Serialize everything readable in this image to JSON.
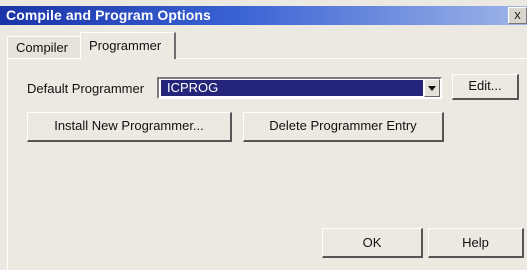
{
  "window": {
    "title": "Compile and Program Options",
    "close_label": "x"
  },
  "tabs": [
    {
      "label": "Compiler",
      "selected": false
    },
    {
      "label": "Programmer",
      "selected": true
    }
  ],
  "programmer": {
    "default_label": "Default Programmer",
    "selected_value": "ICPROG",
    "edit_label": "Edit...",
    "install_label": "Install New Programmer...",
    "delete_label": "Delete Programmer Entry"
  },
  "footer": {
    "ok_label": "OK",
    "help_label": "Help"
  },
  "colors": {
    "title_bar": "#1a34a8",
    "selection": "#24247a",
    "dialog_bg": "#ece9e2"
  }
}
